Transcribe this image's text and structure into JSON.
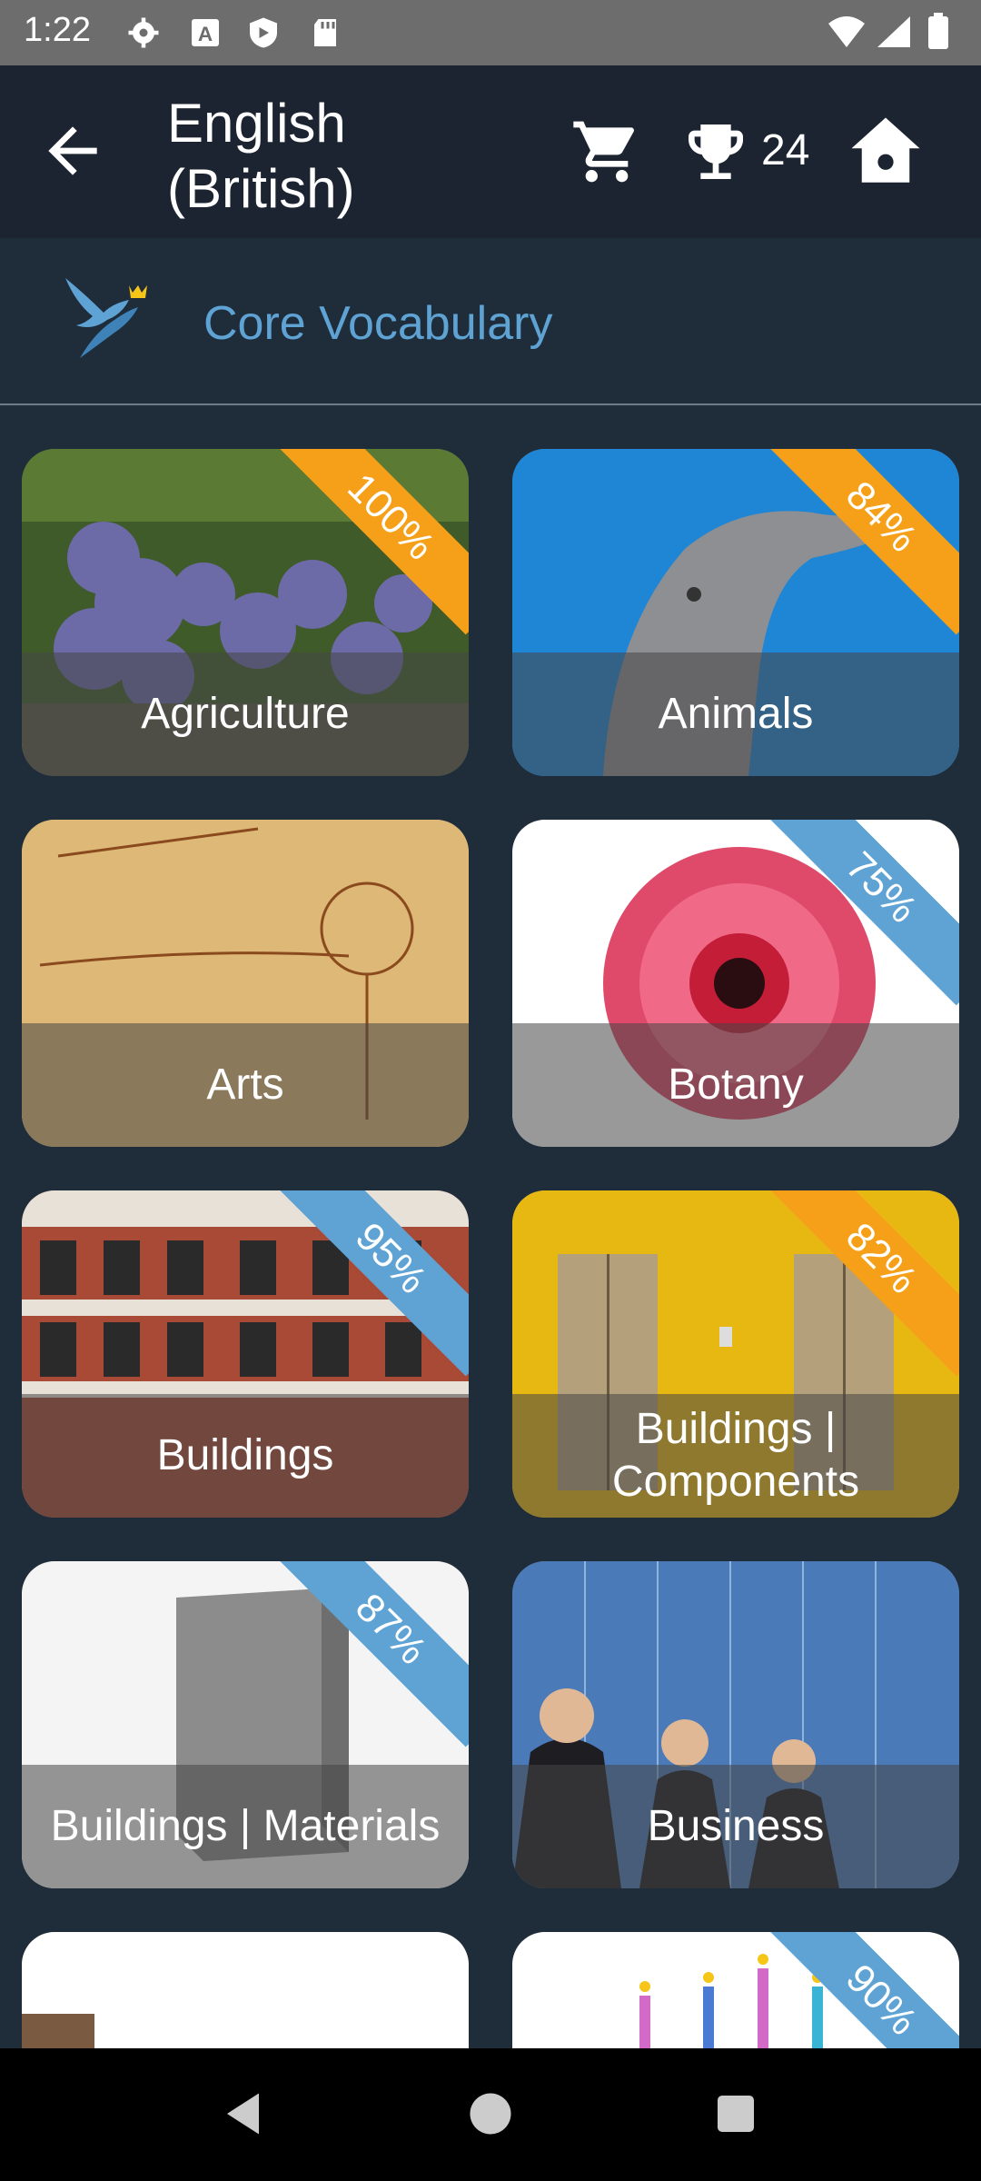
{
  "status_bar": {
    "time": "1:22",
    "icons": [
      "settings-icon",
      "text-a-icon",
      "play-protect-icon",
      "sd-card-icon",
      "wifi-icon",
      "signal-icon",
      "battery-icon"
    ]
  },
  "appbar": {
    "title": "English (British)",
    "trophy_count": "24",
    "icons": [
      "back-arrow-icon",
      "cart-icon",
      "trophy-icon",
      "home-icon"
    ]
  },
  "section": {
    "title": "Core Vocabulary",
    "logo_icon": "bird-crown-icon"
  },
  "categories": [
    {
      "label": "Agriculture",
      "progress": "100%",
      "badge_color": "#f5a018"
    },
    {
      "label": "Animals",
      "progress": "84%",
      "badge_color": "#f5a018"
    },
    {
      "label": "Arts",
      "progress": null,
      "badge_color": null
    },
    {
      "label": "Botany",
      "progress": "75%",
      "badge_color": "#5fa3d4"
    },
    {
      "label": "Buildings",
      "progress": "95%",
      "badge_color": "#5fa3d4"
    },
    {
      "label": "Buildings | Components",
      "progress": "82%",
      "badge_color": "#f5a018"
    },
    {
      "label": "Buildings | Materials",
      "progress": "87%",
      "badge_color": "#5fa3d4"
    },
    {
      "label": "Business",
      "progress": null,
      "badge_color": null
    },
    {
      "label": "",
      "progress": null,
      "badge_color": null
    },
    {
      "label": "",
      "progress": "90%",
      "badge_color": "#5fa3d4"
    }
  ],
  "colors": {
    "background": "#1f2d3b",
    "appbar": "#1b2430",
    "accent_blue": "#5fa3d4",
    "accent_orange": "#f5a018"
  },
  "navbar": {
    "icons": [
      "nav-back-icon",
      "nav-home-icon",
      "nav-recents-icon"
    ]
  }
}
